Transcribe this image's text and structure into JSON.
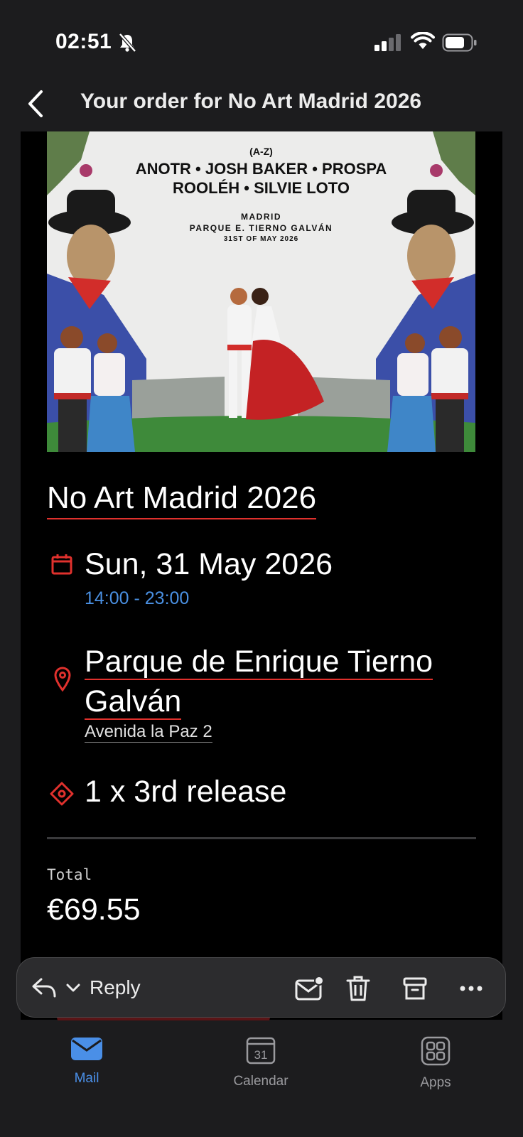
{
  "status": {
    "time": "02:51"
  },
  "header": {
    "title": "Your order for No Art Madrid 2026",
    "back_icon": "chevron-left-icon"
  },
  "poster": {
    "order": "(A-Z)",
    "artists_line1": "ANOTR • JOSH BAKER • PROSPA",
    "artists_line2": "ROOLÉH • SILVIE LOTO",
    "city": "MADRID",
    "venue": "PARQUE E. TIERNO GALVÁN",
    "date": "31ST OF MAY 2026"
  },
  "event": {
    "title": "No Art Madrid 2026",
    "date": "Sun, 31 May 2026",
    "time": "14:00 - 23:00",
    "venue_line1": "Parque de Enrique Tierno",
    "venue_line2": "Galván",
    "address": "Avenida la Paz 2",
    "ticket": "1 x 3rd release",
    "total_label": "Total",
    "total_value": "€69.55"
  },
  "actions": {
    "reply_label": "Reply",
    "icons": [
      "reply-icon",
      "chevron-down-icon",
      "mark-unread-icon",
      "trash-icon",
      "archive-icon",
      "more-icon"
    ]
  },
  "tabs": [
    {
      "label": "Mail",
      "icon": "mail-icon",
      "active": true
    },
    {
      "label": "Calendar",
      "icon": "calendar-icon",
      "badge": "31"
    },
    {
      "label": "Apps",
      "icon": "apps-icon"
    }
  ],
  "colors": {
    "accent_red": "#e0312d",
    "link_blue": "#4a90e2",
    "tab_active": "#4a8fe7",
    "tab_inactive": "#9a9a9e"
  }
}
